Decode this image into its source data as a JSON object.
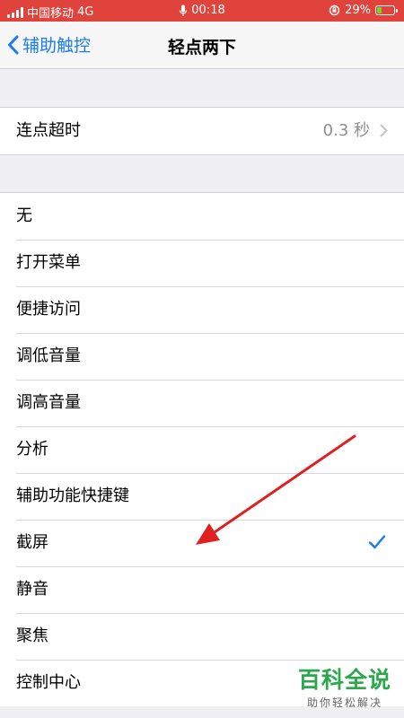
{
  "status_bar": {
    "carrier": "中国移动",
    "network": "4G",
    "time": "00:18",
    "battery_text": "29%",
    "battery_level": 0.29
  },
  "nav": {
    "back_label": "辅助触控",
    "title": "轻点两下"
  },
  "timeout_row": {
    "label": "连点超时",
    "value": "0.3 秒"
  },
  "actions": [
    {
      "label": "无",
      "selected": false
    },
    {
      "label": "打开菜单",
      "selected": false
    },
    {
      "label": "便捷访问",
      "selected": false
    },
    {
      "label": "调低音量",
      "selected": false
    },
    {
      "label": "调高音量",
      "selected": false
    },
    {
      "label": "分析",
      "selected": false
    },
    {
      "label": "辅助功能快捷键",
      "selected": false
    },
    {
      "label": "截屏",
      "selected": true
    },
    {
      "label": "静音",
      "selected": false
    },
    {
      "label": "聚焦",
      "selected": false
    },
    {
      "label": "控制中心",
      "selected": false
    }
  ],
  "watermark": {
    "main": "百科全说",
    "sub": "助你轻松解决"
  },
  "colors": {
    "status_bar_bg": "#e0433c",
    "accent_blue": "#1a7cf5",
    "annotation_red": "#e02020",
    "watermark_green": "#2aa84a"
  }
}
